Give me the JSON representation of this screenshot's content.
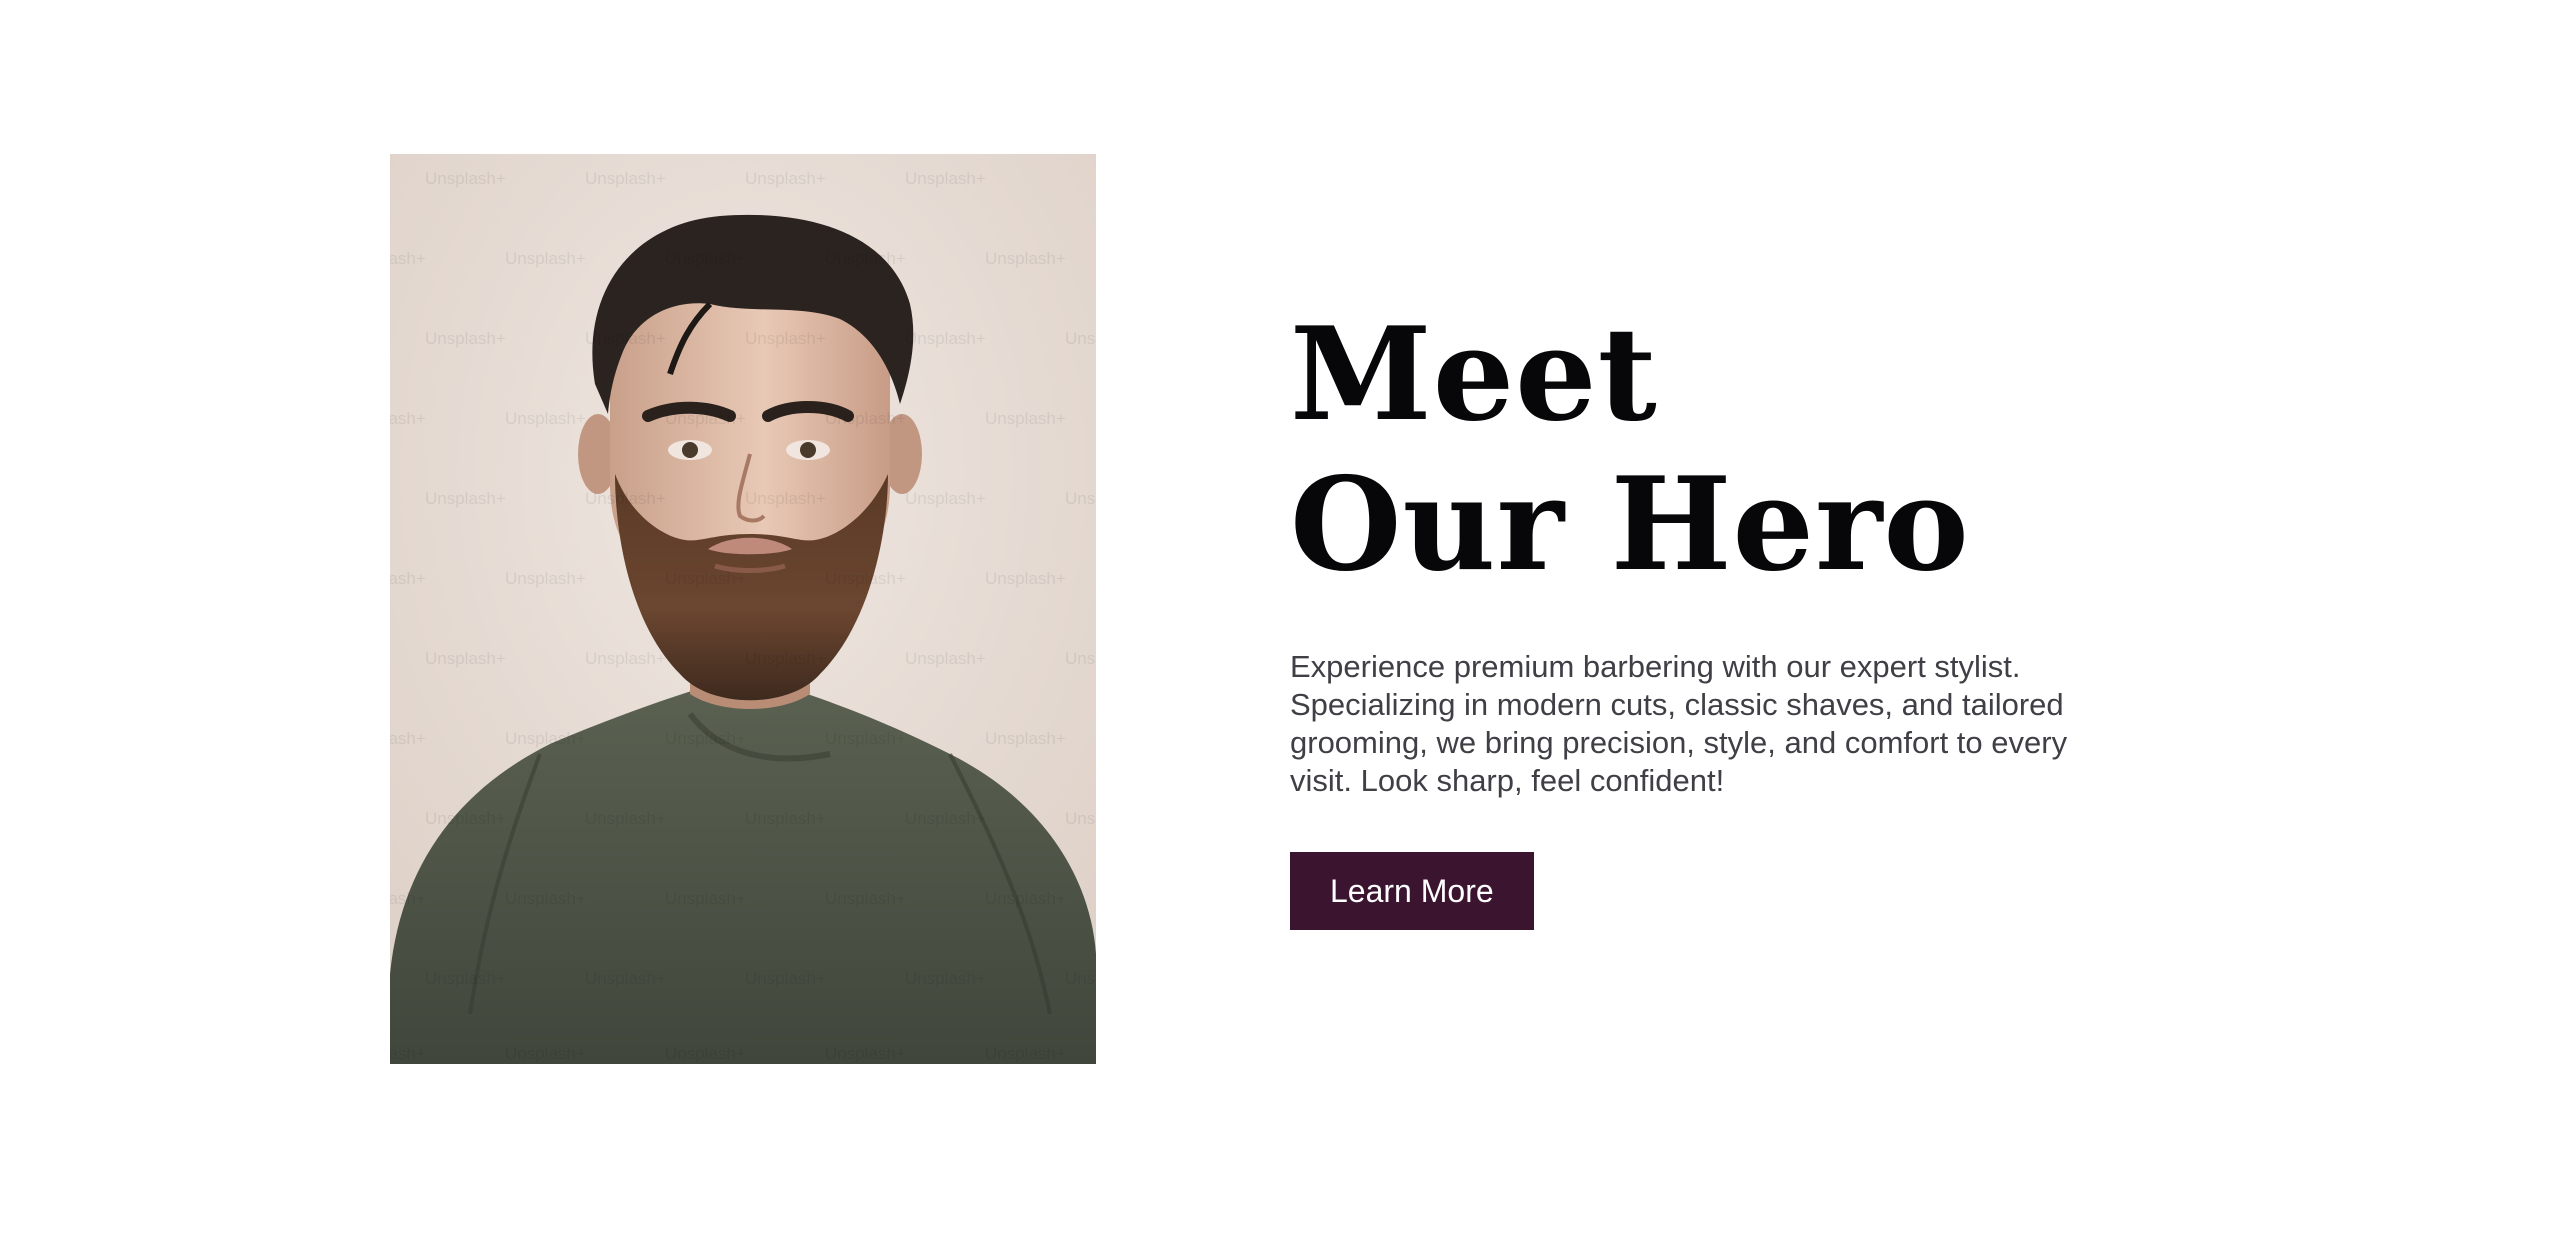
{
  "hero": {
    "title_line_1": "Meet",
    "title_line_2": "Our Hero",
    "description": "Experience premium barbering with our expert stylist. Specializing in modern cuts, classic shaves, and tailored grooming, we bring precision, style, and comfort to every visit. Look sharp, feel confident!",
    "button_label": "Learn More"
  },
  "photo": {
    "alt": "Portrait of a bearded man in a dark green sweatshirt",
    "watermark": "Unsplash+"
  },
  "colors": {
    "button_background": "#3b1530",
    "button_text": "#ffffff",
    "title": "#070709",
    "body_text": "#3f3f46",
    "page_background": "#ffffff"
  }
}
